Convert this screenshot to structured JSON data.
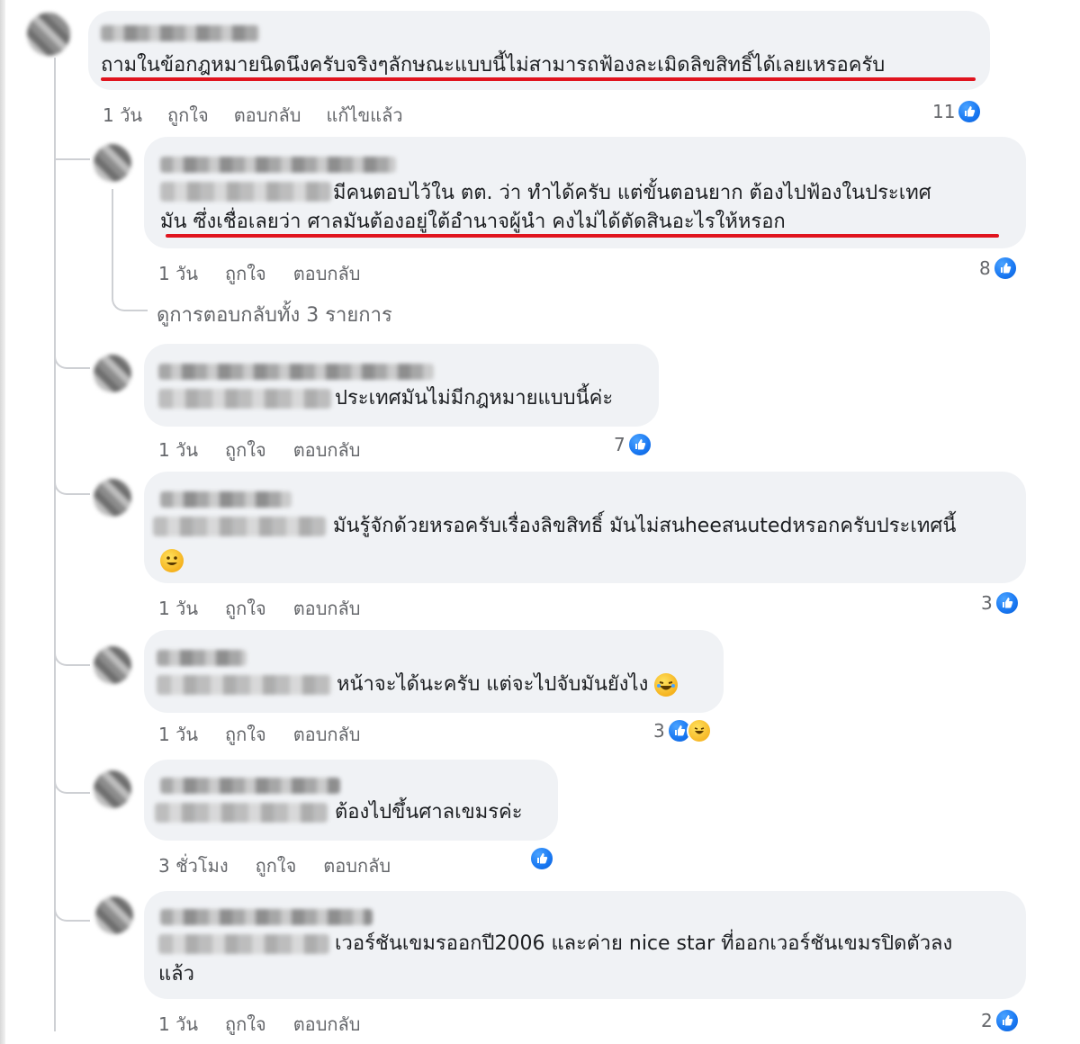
{
  "colors": {
    "bubble": "#f0f2f5",
    "underline": "#e0141e",
    "like": "#1877f2",
    "meta": "#65676b"
  },
  "actions": {
    "like": "ถูกใจ",
    "reply": "ตอบกลับ",
    "edited": "แก้ไขแล้ว"
  },
  "view_replies": "ดูการตอบกลับทั้ง 3 รายการ",
  "comments": [
    {
      "text": "ถามในข้อกฎหมายนิดนึงครับจริงๆลักษณะแบบนี้ไม่สามารถฟ้องละเมิดลิขสิทธิ์ได้เลยเหรอครับ",
      "time": "1 วัน",
      "reactions": "11",
      "reaction_icons": [
        "like-icon"
      ]
    },
    {
      "text_line1": "มีคนตอบไว้ใน ตต. ว่า ทำได้ครับ แต่ขั้นตอนยาก ต้องไปฟ้องในประเทศ",
      "text_line2": "มัน ซึ่งเชื่อเลยว่า ศาลมันต้องอยู่ใต้อำนาจผู้นำ คงไม่ได้ตัดสินอะไรให้หรอก",
      "time": "1 วัน",
      "reactions": "8",
      "reaction_icons": [
        "like-icon"
      ]
    },
    {
      "text": "ประเทศมันไม่มีกฎหมายแบบนี้ค่ะ",
      "time": "1 วัน",
      "reactions": "7",
      "reaction_icons": [
        "like-icon"
      ]
    },
    {
      "text_line1": "มันรู้จักด้วยหรอครับเรื่องลิขสิทธิ์ มันไม่สนheeสนutedหรอกครับประเทศนี้",
      "emoji": "grinning-face-emoji",
      "time": "1 วัน",
      "reactions": "3",
      "reaction_icons": [
        "like-icon"
      ]
    },
    {
      "text": "หน้าจะได้นะครับ แต่จะไปจับมันยังไง",
      "emoji": "laughing-face-emoji",
      "time": "1 วัน",
      "reactions": "3",
      "reaction_icons": [
        "like-icon",
        "haha-icon"
      ]
    },
    {
      "text": "ต้องไปขึ้นศาลเขมรค่ะ",
      "time": "3 ชั่วโมง",
      "reactions": "",
      "reaction_icons": [
        "like-icon"
      ]
    },
    {
      "text_line1": "เวอร์ชันเขมรออกปี2006 และค่าย nice star ที่ออกเวอร์ชันเขมรปิดตัวลง",
      "text_line2": "แล้ว",
      "time": "1 วัน",
      "reactions": "2",
      "reaction_icons": [
        "like-icon"
      ]
    }
  ]
}
